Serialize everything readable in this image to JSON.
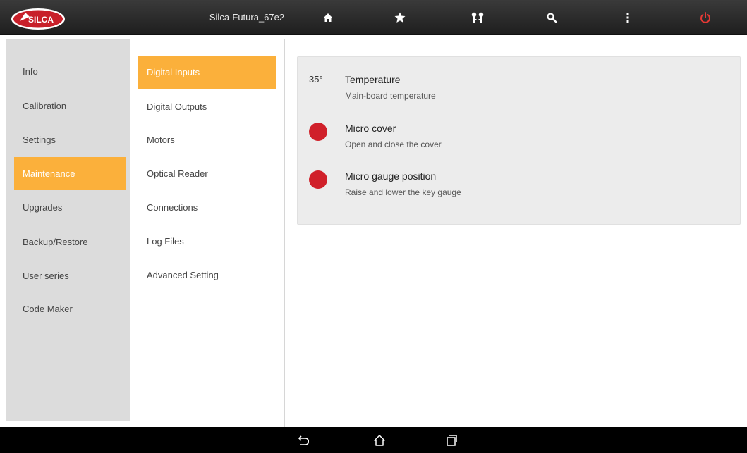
{
  "header": {
    "device_name": "Silca-Futura_67e2",
    "logo_text": "SILCA",
    "icons": [
      "home-icon",
      "star-icon",
      "keys-icon",
      "search-icon",
      "more-vert-icon",
      "power-icon"
    ],
    "power_color": "#e53935"
  },
  "sidebar": {
    "items": [
      {
        "label": "Info"
      },
      {
        "label": "Calibration"
      },
      {
        "label": "Settings"
      },
      {
        "label": "Maintenance",
        "active": true
      },
      {
        "label": "Upgrades"
      },
      {
        "label": "Backup/Restore"
      },
      {
        "label": "User series"
      },
      {
        "label": "Code Maker"
      }
    ]
  },
  "submenu": {
    "items": [
      {
        "label": "Digital Inputs",
        "active": true
      },
      {
        "label": "Digital Outputs"
      },
      {
        "label": "Motors"
      },
      {
        "label": "Optical Reader"
      },
      {
        "label": "Connections"
      },
      {
        "label": "Log Files"
      },
      {
        "label": "Advanced Setting"
      }
    ]
  },
  "main": {
    "rows": [
      {
        "value": "35°",
        "title": "Temperature",
        "description": "Main-board temperature"
      },
      {
        "status_color": "#d0202a",
        "title": "Micro cover",
        "description": "Open and close the cover"
      },
      {
        "status_color": "#d0202a",
        "title": "Micro gauge position",
        "description": "Raise and lower the key gauge"
      }
    ]
  },
  "colors": {
    "accent": "#fbb03b",
    "status_off": "#d0202a"
  },
  "navbar": {
    "icons": [
      "back-icon",
      "home-outline-icon",
      "recent-apps-icon"
    ]
  }
}
